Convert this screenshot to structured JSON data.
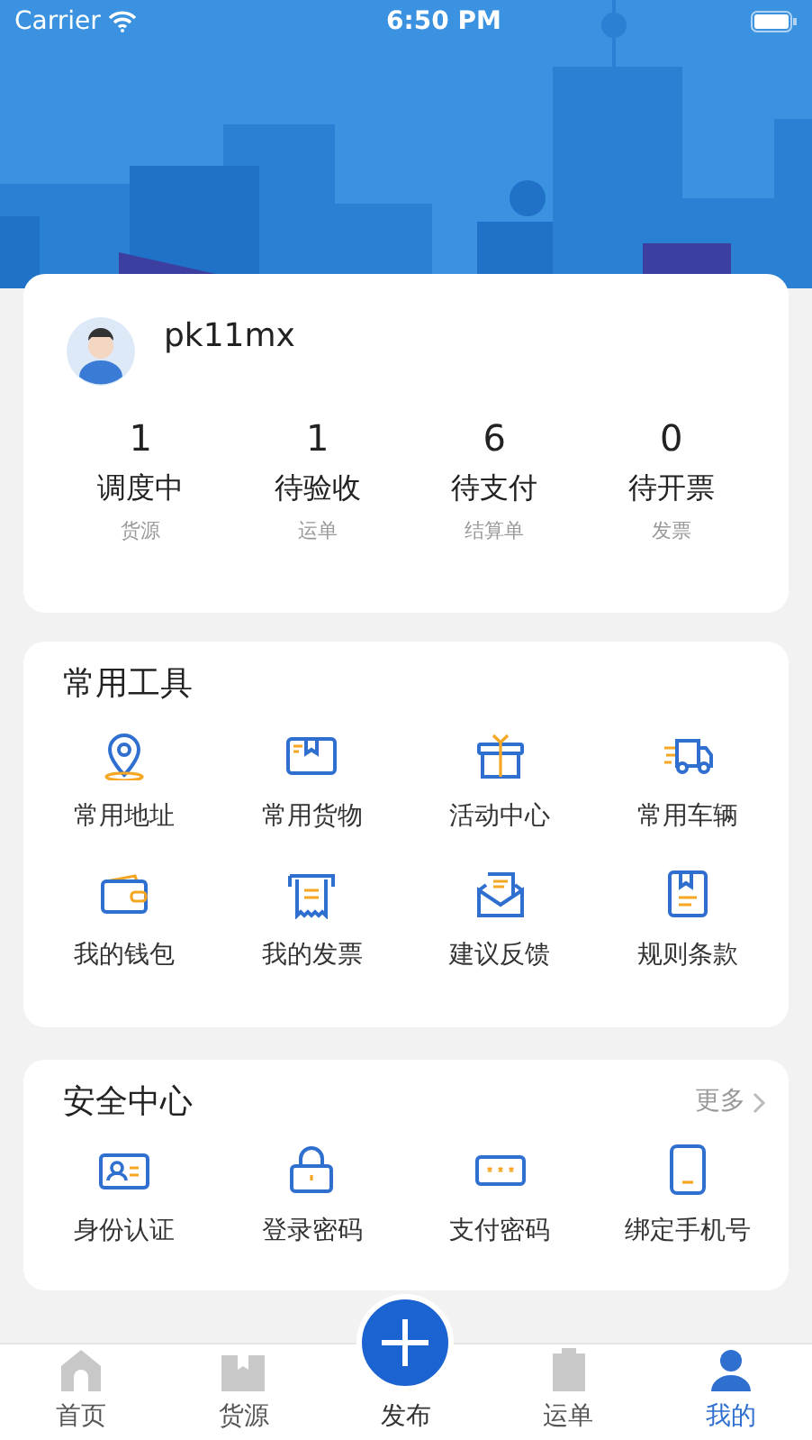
{
  "status_bar": {
    "carrier": "Carrier",
    "time": "6:50 PM"
  },
  "profile": {
    "username": "pk11mx",
    "stats": [
      {
        "count": "1",
        "label": "调度中",
        "sub": "货源"
      },
      {
        "count": "1",
        "label": "待验收",
        "sub": "运单"
      },
      {
        "count": "6",
        "label": "待支付",
        "sub": "结算单"
      },
      {
        "count": "0",
        "label": "待开票",
        "sub": "发票"
      }
    ]
  },
  "tools": {
    "title": "常用工具",
    "items": [
      "常用地址",
      "常用货物",
      "活动中心",
      "常用车辆",
      "我的钱包",
      "我的发票",
      "建议反馈",
      "规则条款"
    ]
  },
  "security": {
    "title": "安全中心",
    "more": "更多",
    "items": [
      "身份认证",
      "登录密码",
      "支付密码",
      "绑定手机号"
    ]
  },
  "tab_bar": [
    {
      "label": "首页",
      "selected": false
    },
    {
      "label": "货源",
      "selected": false
    },
    {
      "label": "发布",
      "selected": false,
      "kind": "publish"
    },
    {
      "label": "运单",
      "selected": false
    },
    {
      "label": "我的",
      "selected": true
    }
  ]
}
